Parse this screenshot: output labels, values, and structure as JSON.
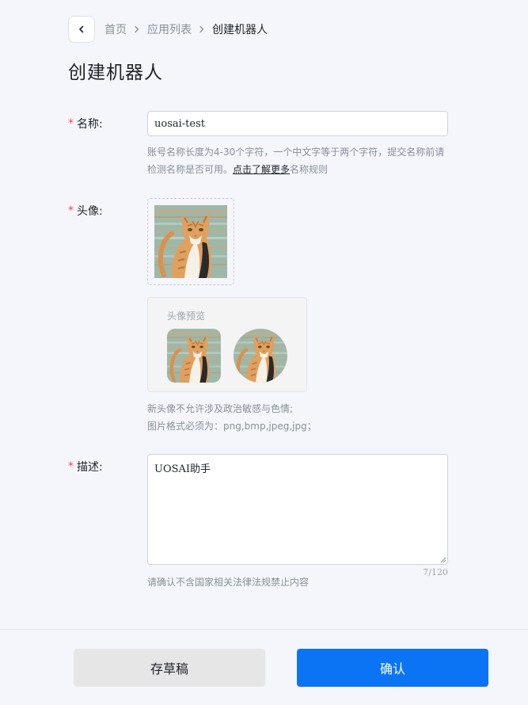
{
  "breadcrumb": {
    "items": [
      "首页",
      "应用列表"
    ],
    "current": "创建机器人"
  },
  "page": {
    "title": "创建机器人"
  },
  "form": {
    "name": {
      "required_mark": "*",
      "label": "名称:",
      "value": "uosai-test",
      "hint_line1": "账号名称长度为4-30个字符，一个中文字等于两个字符，提交名称前请",
      "hint_line2_prefix": "检测名称是否可用。",
      "hint_link": "点击了解更多",
      "hint_line2_suffix": "名称规则"
    },
    "avatar": {
      "required_mark": "*",
      "label": "头像:",
      "preview_title": "头像预览",
      "hint_line1": "新头像不允许涉及政治敏感与色情;",
      "hint_line2": "图片格式必须为：png,bmp,jpeg,jpg；"
    },
    "description": {
      "required_mark": "*",
      "label": "描述:",
      "value": "UOSAI助手",
      "counter": "7/120",
      "hint": "请确认不含国家相关法律法规禁止内容"
    }
  },
  "footer": {
    "draft_label": "存草稿",
    "confirm_label": "确认"
  },
  "colors": {
    "accent": "#0b74f5",
    "required": "#f54a45",
    "background": "#f4f6fc"
  },
  "icons": {
    "back": "chevron-left-icon",
    "breadcrumb_separator": "chevron-right-icon"
  }
}
